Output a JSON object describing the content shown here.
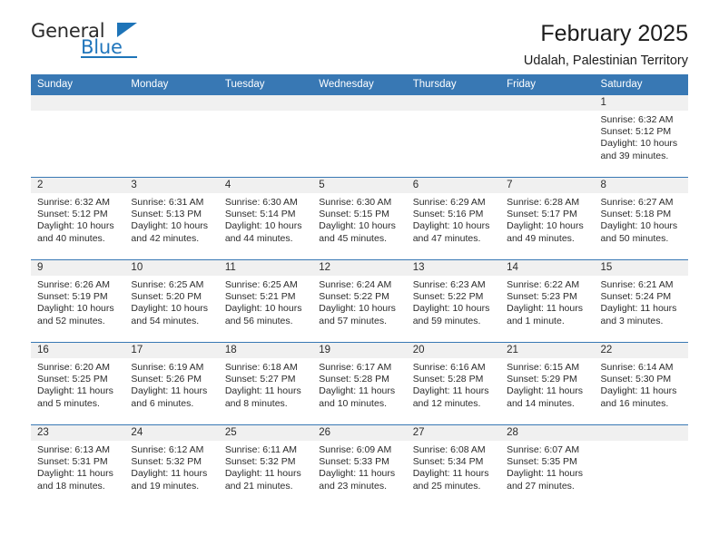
{
  "brand": {
    "name_part1": "General",
    "name_part2": "Blue"
  },
  "header": {
    "title": "February 2025",
    "subtitle": "Udalah, Palestinian Territory"
  },
  "colors": {
    "header_blue": "#3878b4",
    "brand_blue": "#2176bc",
    "band_gray": "#f0f0f0",
    "text": "#2b2b2b"
  },
  "weekday_headers": [
    "Sunday",
    "Monday",
    "Tuesday",
    "Wednesday",
    "Thursday",
    "Friday",
    "Saturday"
  ],
  "weeks": [
    [
      {
        "day": "",
        "sunrise": "",
        "sunset": "",
        "daylight": "",
        "empty": true
      },
      {
        "day": "",
        "sunrise": "",
        "sunset": "",
        "daylight": "",
        "empty": true
      },
      {
        "day": "",
        "sunrise": "",
        "sunset": "",
        "daylight": "",
        "empty": true
      },
      {
        "day": "",
        "sunrise": "",
        "sunset": "",
        "daylight": "",
        "empty": true
      },
      {
        "day": "",
        "sunrise": "",
        "sunset": "",
        "daylight": "",
        "empty": true
      },
      {
        "day": "",
        "sunrise": "",
        "sunset": "",
        "daylight": "",
        "empty": true
      },
      {
        "day": "1",
        "sunrise": "Sunrise: 6:32 AM",
        "sunset": "Sunset: 5:12 PM",
        "daylight": "Daylight: 10 hours and 39 minutes.",
        "empty": false
      }
    ],
    [
      {
        "day": "2",
        "sunrise": "Sunrise: 6:32 AM",
        "sunset": "Sunset: 5:12 PM",
        "daylight": "Daylight: 10 hours and 40 minutes.",
        "empty": false
      },
      {
        "day": "3",
        "sunrise": "Sunrise: 6:31 AM",
        "sunset": "Sunset: 5:13 PM",
        "daylight": "Daylight: 10 hours and 42 minutes.",
        "empty": false
      },
      {
        "day": "4",
        "sunrise": "Sunrise: 6:30 AM",
        "sunset": "Sunset: 5:14 PM",
        "daylight": "Daylight: 10 hours and 44 minutes.",
        "empty": false
      },
      {
        "day": "5",
        "sunrise": "Sunrise: 6:30 AM",
        "sunset": "Sunset: 5:15 PM",
        "daylight": "Daylight: 10 hours and 45 minutes.",
        "empty": false
      },
      {
        "day": "6",
        "sunrise": "Sunrise: 6:29 AM",
        "sunset": "Sunset: 5:16 PM",
        "daylight": "Daylight: 10 hours and 47 minutes.",
        "empty": false
      },
      {
        "day": "7",
        "sunrise": "Sunrise: 6:28 AM",
        "sunset": "Sunset: 5:17 PM",
        "daylight": "Daylight: 10 hours and 49 minutes.",
        "empty": false
      },
      {
        "day": "8",
        "sunrise": "Sunrise: 6:27 AM",
        "sunset": "Sunset: 5:18 PM",
        "daylight": "Daylight: 10 hours and 50 minutes.",
        "empty": false
      }
    ],
    [
      {
        "day": "9",
        "sunrise": "Sunrise: 6:26 AM",
        "sunset": "Sunset: 5:19 PM",
        "daylight": "Daylight: 10 hours and 52 minutes.",
        "empty": false
      },
      {
        "day": "10",
        "sunrise": "Sunrise: 6:25 AM",
        "sunset": "Sunset: 5:20 PM",
        "daylight": "Daylight: 10 hours and 54 minutes.",
        "empty": false
      },
      {
        "day": "11",
        "sunrise": "Sunrise: 6:25 AM",
        "sunset": "Sunset: 5:21 PM",
        "daylight": "Daylight: 10 hours and 56 minutes.",
        "empty": false
      },
      {
        "day": "12",
        "sunrise": "Sunrise: 6:24 AM",
        "sunset": "Sunset: 5:22 PM",
        "daylight": "Daylight: 10 hours and 57 minutes.",
        "empty": false
      },
      {
        "day": "13",
        "sunrise": "Sunrise: 6:23 AM",
        "sunset": "Sunset: 5:22 PM",
        "daylight": "Daylight: 10 hours and 59 minutes.",
        "empty": false
      },
      {
        "day": "14",
        "sunrise": "Sunrise: 6:22 AM",
        "sunset": "Sunset: 5:23 PM",
        "daylight": "Daylight: 11 hours and 1 minute.",
        "empty": false
      },
      {
        "day": "15",
        "sunrise": "Sunrise: 6:21 AM",
        "sunset": "Sunset: 5:24 PM",
        "daylight": "Daylight: 11 hours and 3 minutes.",
        "empty": false
      }
    ],
    [
      {
        "day": "16",
        "sunrise": "Sunrise: 6:20 AM",
        "sunset": "Sunset: 5:25 PM",
        "daylight": "Daylight: 11 hours and 5 minutes.",
        "empty": false
      },
      {
        "day": "17",
        "sunrise": "Sunrise: 6:19 AM",
        "sunset": "Sunset: 5:26 PM",
        "daylight": "Daylight: 11 hours and 6 minutes.",
        "empty": false
      },
      {
        "day": "18",
        "sunrise": "Sunrise: 6:18 AM",
        "sunset": "Sunset: 5:27 PM",
        "daylight": "Daylight: 11 hours and 8 minutes.",
        "empty": false
      },
      {
        "day": "19",
        "sunrise": "Sunrise: 6:17 AM",
        "sunset": "Sunset: 5:28 PM",
        "daylight": "Daylight: 11 hours and 10 minutes.",
        "empty": false
      },
      {
        "day": "20",
        "sunrise": "Sunrise: 6:16 AM",
        "sunset": "Sunset: 5:28 PM",
        "daylight": "Daylight: 11 hours and 12 minutes.",
        "empty": false
      },
      {
        "day": "21",
        "sunrise": "Sunrise: 6:15 AM",
        "sunset": "Sunset: 5:29 PM",
        "daylight": "Daylight: 11 hours and 14 minutes.",
        "empty": false
      },
      {
        "day": "22",
        "sunrise": "Sunrise: 6:14 AM",
        "sunset": "Sunset: 5:30 PM",
        "daylight": "Daylight: 11 hours and 16 minutes.",
        "empty": false
      }
    ],
    [
      {
        "day": "23",
        "sunrise": "Sunrise: 6:13 AM",
        "sunset": "Sunset: 5:31 PM",
        "daylight": "Daylight: 11 hours and 18 minutes.",
        "empty": false
      },
      {
        "day": "24",
        "sunrise": "Sunrise: 6:12 AM",
        "sunset": "Sunset: 5:32 PM",
        "daylight": "Daylight: 11 hours and 19 minutes.",
        "empty": false
      },
      {
        "day": "25",
        "sunrise": "Sunrise: 6:11 AM",
        "sunset": "Sunset: 5:32 PM",
        "daylight": "Daylight: 11 hours and 21 minutes.",
        "empty": false
      },
      {
        "day": "26",
        "sunrise": "Sunrise: 6:09 AM",
        "sunset": "Sunset: 5:33 PM",
        "daylight": "Daylight: 11 hours and 23 minutes.",
        "empty": false
      },
      {
        "day": "27",
        "sunrise": "Sunrise: 6:08 AM",
        "sunset": "Sunset: 5:34 PM",
        "daylight": "Daylight: 11 hours and 25 minutes.",
        "empty": false
      },
      {
        "day": "28",
        "sunrise": "Sunrise: 6:07 AM",
        "sunset": "Sunset: 5:35 PM",
        "daylight": "Daylight: 11 hours and 27 minutes.",
        "empty": false
      },
      {
        "day": "",
        "sunrise": "",
        "sunset": "",
        "daylight": "",
        "empty": true
      }
    ]
  ]
}
